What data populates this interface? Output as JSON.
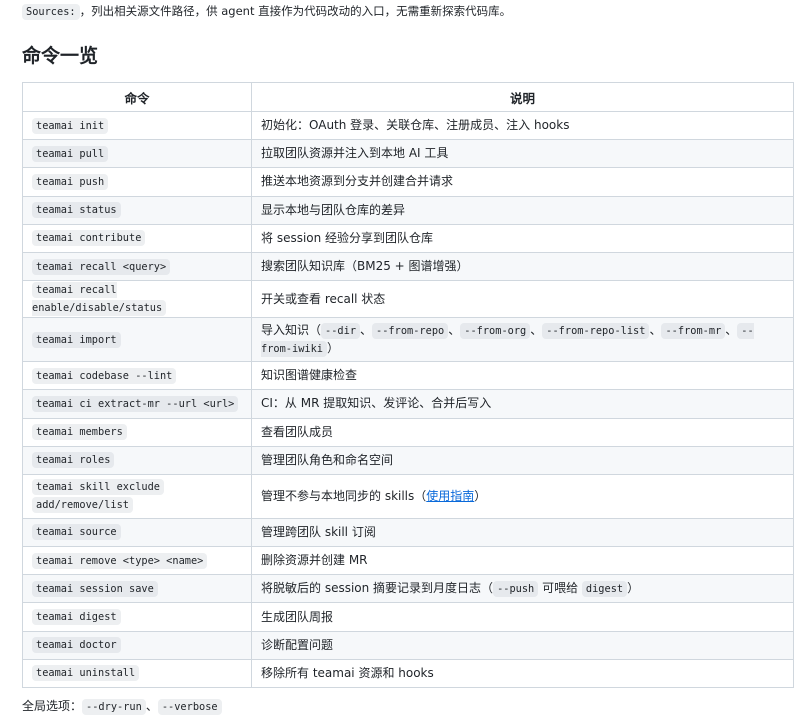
{
  "intro": {
    "code": "Sources:",
    "text": "，列出相关源文件路径，供 agent 直接作为代码改动的入口，无需重新探索代码库。"
  },
  "section_title": "命令一览",
  "table": {
    "headers": [
      "命令",
      "说明"
    ],
    "rows": [
      {
        "cmd": "teamai init",
        "desc": "初始化：OAuth 登录、关联仓库、注册成员、注入 hooks"
      },
      {
        "cmd": "teamai pull",
        "desc": "拉取团队资源并注入到本地 AI 工具"
      },
      {
        "cmd": "teamai push",
        "desc": "推送本地资源到分支并创建合并请求"
      },
      {
        "cmd": "teamai status",
        "desc": "显示本地与团队仓库的差异"
      },
      {
        "cmd": "teamai contribute",
        "desc": "将 session 经验分享到团队仓库"
      },
      {
        "cmd": "teamai recall <query>",
        "desc": "搜索团队知识库（BM25 + 图谱增强）"
      },
      {
        "cmd": "teamai recall enable/disable/status",
        "desc": "开关或查看 recall 状态"
      },
      {
        "cmd": "teamai import",
        "desc_pre": "导入知识（",
        "desc_codes": [
          "--dir",
          "--from-repo",
          "--from-org",
          "--from-repo-list",
          "--from-mr",
          "--from-iwiki"
        ],
        "desc_sep": "、",
        "desc_post": "）"
      },
      {
        "cmd": "teamai codebase --lint",
        "desc": "知识图谱健康检查"
      },
      {
        "cmd": "teamai ci extract-mr --url <url>",
        "desc": "CI：从 MR 提取知识、发评论、合并后写入"
      },
      {
        "cmd": "teamai members",
        "desc": "查看团队成员"
      },
      {
        "cmd": "teamai roles",
        "desc": "管理团队角色和命名空间"
      },
      {
        "cmd_line1": "teamai skill exclude",
        "cmd_line2": "add/remove/list",
        "desc_pre": "管理不参与本地同步的 skills（",
        "desc_link": "使用指南",
        "desc_post": "）"
      },
      {
        "cmd": "teamai source",
        "desc": "管理跨团队 skill 订阅"
      },
      {
        "cmd": "teamai remove <type> <name>",
        "desc": "删除资源并创建 MR"
      },
      {
        "cmd": "teamai session save",
        "desc_pre": "将脱敏后的 session 摘要记录到月度日志（",
        "desc_code1": "--push",
        "desc_mid": " 可喂给 ",
        "desc_code2": "digest",
        "desc_post": "）"
      },
      {
        "cmd": "teamai digest",
        "desc": "生成团队周报"
      },
      {
        "cmd": "teamai doctor",
        "desc": "诊断配置问题"
      },
      {
        "cmd": "teamai uninstall",
        "desc": "移除所有 teamai 资源和 hooks"
      }
    ]
  },
  "footer": {
    "label": "全局选项：",
    "opt1": "--dry-run",
    "sep": "、",
    "opt2": "--verbose"
  }
}
